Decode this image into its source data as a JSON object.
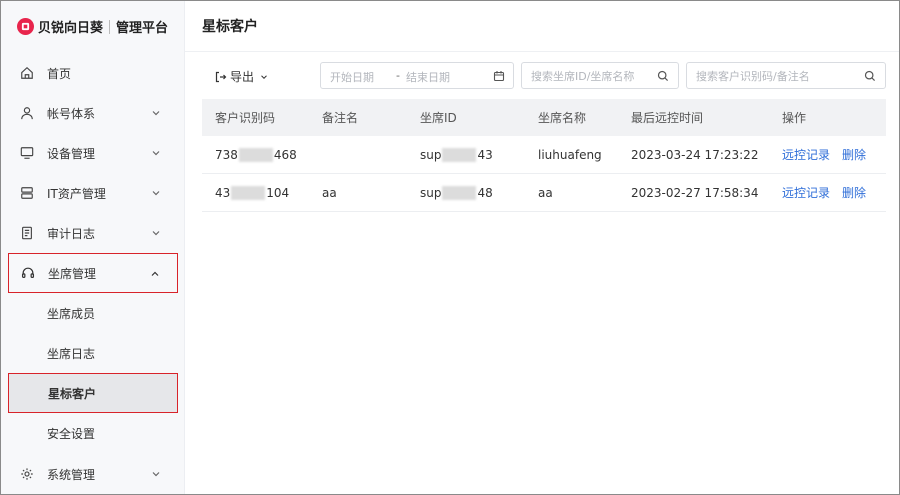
{
  "brand": {
    "name": "贝锐向日葵",
    "subtitle": "管理平台"
  },
  "sidebar": {
    "items": [
      {
        "label": "首页",
        "icon": "home-icon"
      },
      {
        "label": "帐号体系",
        "icon": "user-icon"
      },
      {
        "label": "设备管理",
        "icon": "monitor-icon"
      },
      {
        "label": "IT资产管理",
        "icon": "server-icon"
      },
      {
        "label": "审计日志",
        "icon": "document-icon"
      },
      {
        "label": "坐席管理",
        "icon": "headset-icon",
        "expanded": true
      },
      {
        "label": "系统管理",
        "icon": "gear-icon"
      }
    ],
    "subitems": [
      {
        "label": "坐席成员"
      },
      {
        "label": "坐席日志"
      },
      {
        "label": "星标客户",
        "active": true
      },
      {
        "label": "安全设置"
      }
    ]
  },
  "page": {
    "title": "星标客户"
  },
  "toolbar": {
    "export_label": "导出",
    "date_start_placeholder": "开始日期",
    "date_separator": "-",
    "date_end_placeholder": "结束日期",
    "search_agent_placeholder": "搜索坐席ID/坐席名称",
    "search_customer_placeholder": "搜索客户识别码/备注名"
  },
  "table": {
    "headers": [
      "客户识别码",
      "备注名",
      "坐席ID",
      "坐席名称",
      "最后远控时间",
      "操作"
    ],
    "rows": [
      {
        "customer_id_prefix": "738",
        "customer_id_suffix": "468",
        "remark": "",
        "agent_id_prefix": "sup",
        "agent_id_suffix": "43",
        "agent_name": "liuhuafeng",
        "last_time": "2023-03-24 17:23:22",
        "actions": [
          "远控记录",
          "删除"
        ]
      },
      {
        "customer_id_prefix": "43",
        "customer_id_suffix": "104",
        "remark": "aa",
        "agent_id_prefix": "sup",
        "agent_id_suffix": "48",
        "agent_name": "aa",
        "last_time": "2023-02-27 17:58:34",
        "actions": [
          "远控记录",
          "删除"
        ]
      }
    ]
  },
  "colors": {
    "brand": "#e8254c",
    "link": "#2f6ed8",
    "highlight": "#d8232a"
  }
}
